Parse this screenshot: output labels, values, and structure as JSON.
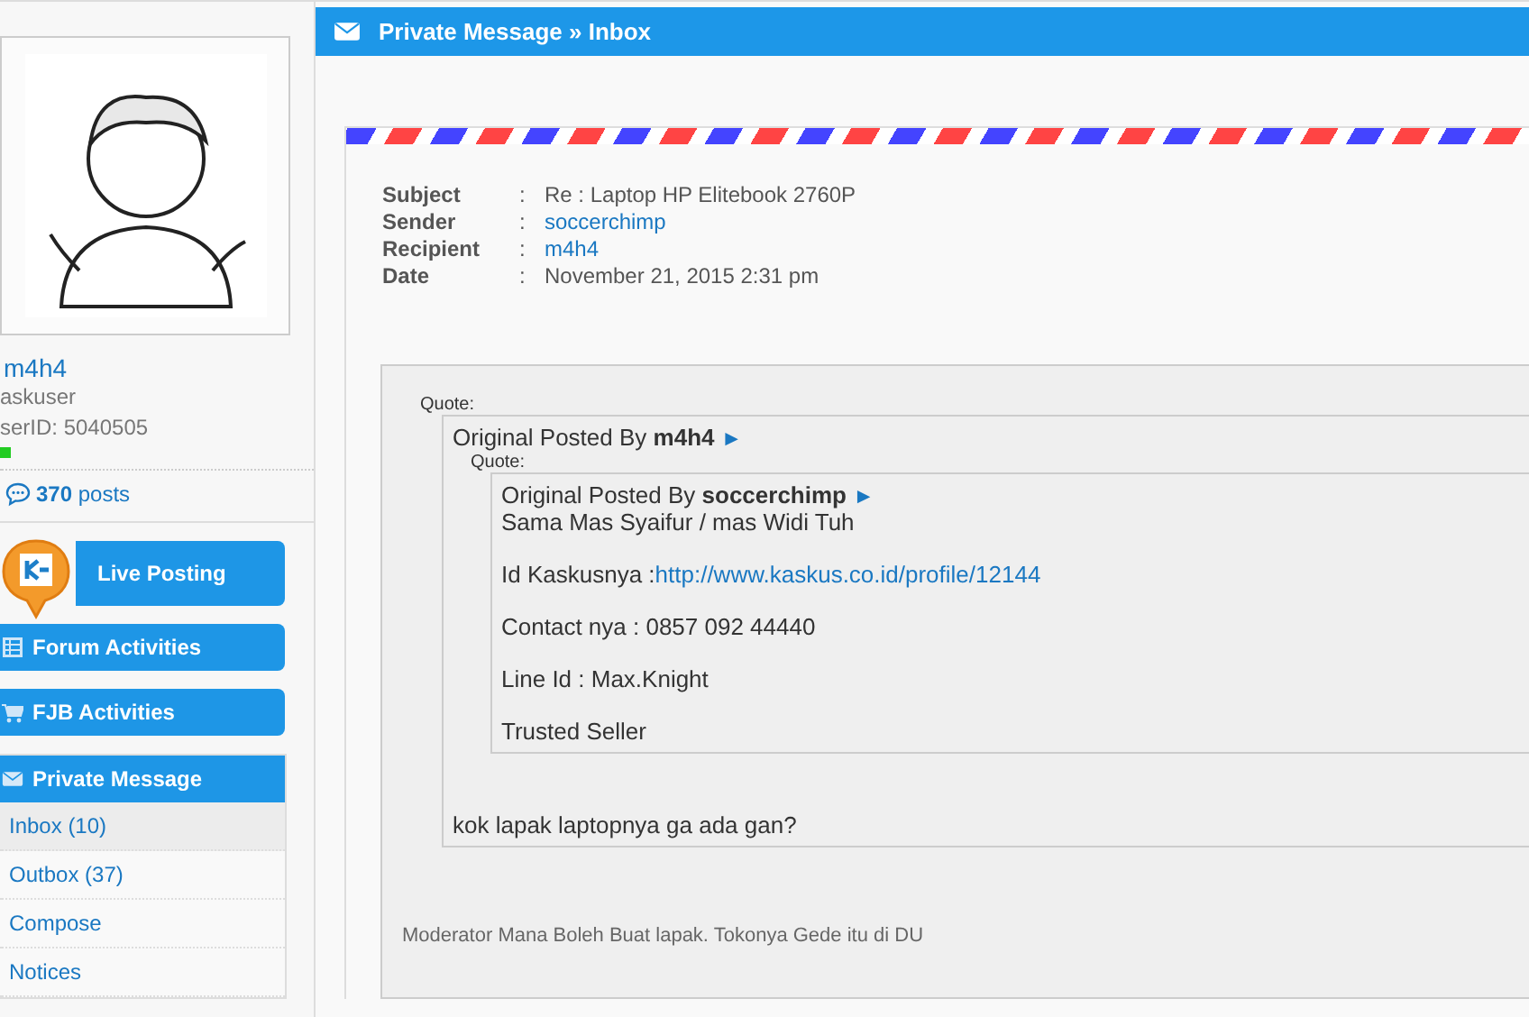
{
  "sidebar": {
    "profile": {
      "username": "m4h4",
      "rank": "askuser",
      "user_id": "serID: 5040505",
      "online": true,
      "posts_count": "370",
      "posts_label": "posts"
    },
    "buttons": [
      {
        "label": "Live Posting",
        "kind": "live"
      },
      {
        "label": "Forum Activities",
        "kind": "forum"
      },
      {
        "label": "FJB Activities",
        "kind": "fjb"
      }
    ],
    "private_message": {
      "title": "Private Message",
      "items": [
        {
          "label": "Inbox (10)",
          "selected": true
        },
        {
          "label": "Outbox (37)",
          "selected": false
        },
        {
          "label": "Compose",
          "selected": false
        },
        {
          "label": "Notices",
          "selected": false
        }
      ]
    }
  },
  "header": {
    "title": "Private Message » Inbox"
  },
  "message": {
    "separator": ":",
    "fields": [
      {
        "label": "Subject",
        "value": "Re : Laptop HP Elitebook 2760P",
        "link": false
      },
      {
        "label": "Sender",
        "value": "soccerchimp",
        "link": true
      },
      {
        "label": "Recipient",
        "value": "m4h4",
        "link": true
      },
      {
        "label": "Date",
        "value": "November 21, 2015 2:31 pm",
        "link": false
      }
    ],
    "quote": {
      "label": "Quote:",
      "prefix": "Original Posted By",
      "author": "m4h4",
      "arrow": "►",
      "nested": {
        "label": "Quote:",
        "prefix": "Original Posted By",
        "author": "soccerchimp",
        "arrow": "►",
        "lines": [
          {
            "text": "Sama Mas Syaifur / mas Widi Tuh"
          },
          {
            "text": "Id Kaskusnya :",
            "link": "http://www.kaskus.co.id/profile/12144"
          },
          {
            "text": "Contact nya : 0857 092 44440"
          },
          {
            "text": "Line Id : Max.Knight"
          },
          {
            "text": "Trusted Seller"
          }
        ]
      },
      "reply": "kok lapak laptopnya ga ada gan?"
    },
    "signature": "Moderator Mana Boleh Buat lapak. Tokonya Gede itu di DU"
  }
}
